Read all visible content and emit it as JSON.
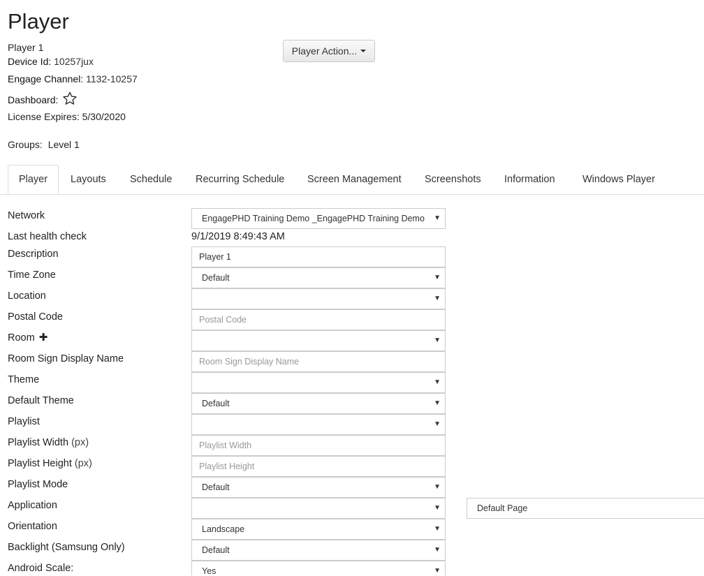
{
  "page": {
    "title": "Player",
    "player_name": "Player 1",
    "device_id_label": "Device Id:",
    "device_id": "10257jux",
    "channel_label": "Engage Channel:",
    "channel": "1132-10257",
    "dashboard_label": "Dashboard:",
    "license_text": "License Expires: 5/30/2020",
    "groups_label": "Groups:",
    "groups_value": "Level 1",
    "action_button": "Player Action..."
  },
  "tabs": [
    "Player",
    "Layouts",
    "Schedule",
    "Recurring Schedule",
    "Screen Management",
    "Screenshots",
    "Information",
    "Windows Player"
  ],
  "form": {
    "network": {
      "label": "Network",
      "value": "EngagePHD Training Demo _EngagePHD Training Demo"
    },
    "health": {
      "label": "Last health check",
      "value": "9/1/2019 8:49:43 AM"
    },
    "description": {
      "label": "Description",
      "value": "Player 1"
    },
    "timezone": {
      "label": "Time Zone",
      "value": "Default"
    },
    "location": {
      "label": "Location",
      "value": ""
    },
    "postal": {
      "label": "Postal Code",
      "placeholder": "Postal Code"
    },
    "room": {
      "label": "Room",
      "value": ""
    },
    "roomsign": {
      "label": "Room Sign Display Name",
      "placeholder": "Room Sign Display Name"
    },
    "theme": {
      "label": "Theme",
      "value": ""
    },
    "default_theme": {
      "label": "Default Theme",
      "value": "Default"
    },
    "playlist": {
      "label": "Playlist",
      "value": ""
    },
    "playlist_width": {
      "label": "Playlist Width",
      "unit": "(px)",
      "placeholder": "Playlist Width"
    },
    "playlist_height": {
      "label": "Playlist Height",
      "unit": "(px)",
      "placeholder": "Playlist Height"
    },
    "playlist_mode": {
      "label": "Playlist Mode",
      "value": "Default"
    },
    "application": {
      "label": "Application",
      "value": "",
      "page_value": "Default Page"
    },
    "orientation": {
      "label": "Orientation",
      "value": "Landscape"
    },
    "backlight": {
      "label": "Backlight (Samsung Only)",
      "value": "Default"
    },
    "android_scale": {
      "label": "Android Scale:",
      "value": "Yes"
    }
  },
  "icons": {
    "dashboard": "star-outline-icon",
    "room_add": "plus-icon",
    "dropdown": "caret-down-icon"
  }
}
